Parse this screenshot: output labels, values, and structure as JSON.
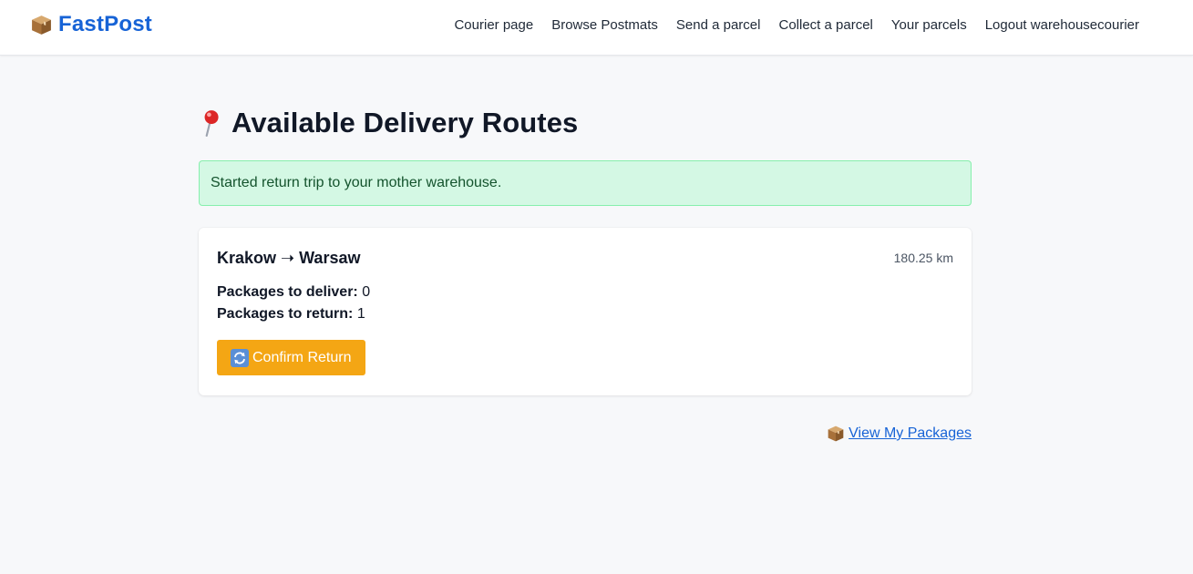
{
  "brand": {
    "name": "FastPost",
    "icon": "package-icon",
    "color": "#1763d6"
  },
  "nav": {
    "items": [
      {
        "label": "Courier page"
      },
      {
        "label": "Browse Postmats"
      },
      {
        "label": "Send a parcel"
      },
      {
        "label": "Collect a parcel"
      },
      {
        "label": "Your parcels"
      },
      {
        "label": "Logout warehousecourier"
      }
    ]
  },
  "page": {
    "title": "Available Delivery Routes",
    "title_icon": "pin-icon"
  },
  "alert": {
    "message": "Started return trip to your mother warehouse.",
    "type": "success",
    "background": "#d4f8e4",
    "border": "#86efac"
  },
  "routes": [
    {
      "name": "Krakow ➝ Warsaw",
      "distance": "180.25 km",
      "deliver_label": "Packages to deliver:",
      "deliver_count": "0",
      "return_label": "Packages to return:",
      "return_count": "1",
      "button_label": "Confirm Return",
      "button_icon": "return-arrows-icon",
      "button_color": "#f4a614"
    }
  ],
  "footer": {
    "link_label": "View My Packages",
    "link_icon": "package-icon"
  }
}
